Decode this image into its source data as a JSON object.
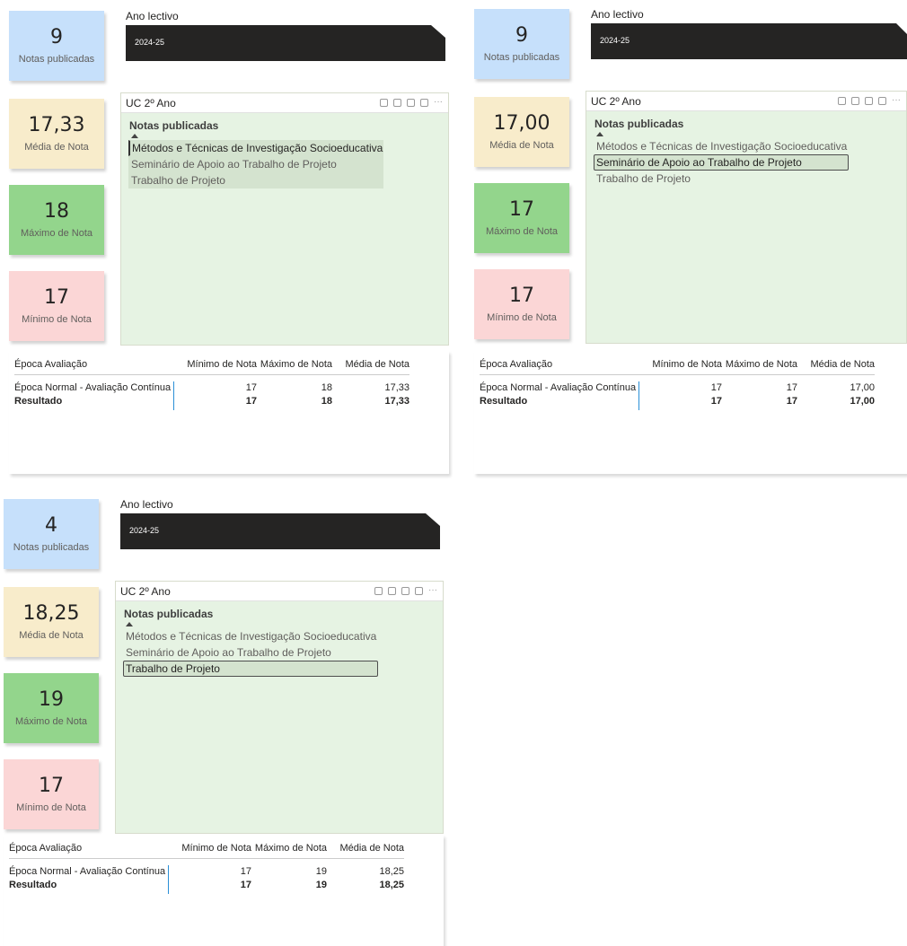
{
  "panels": [
    {
      "notas_publicadas": {
        "value": "9",
        "label": "Notas publicadas"
      },
      "media_nota": {
        "value": "17,33",
        "label": "Média de Nota"
      },
      "maximo_nota": {
        "value": "18",
        "label": "Máximo de Nota"
      },
      "minimo_nota": {
        "value": "17",
        "label": "Mínimo de Nota"
      },
      "ano_lectivo": {
        "label": "Ano lectivo",
        "value": "2024-25"
      },
      "uc": {
        "title": "UC 2º Ano",
        "list_header": "Notas publicadas",
        "items": [
          "Métodos e Técnicas de Investigação Socioeducativa",
          "Seminário de Apoio ao Trabalho de Projeto",
          "Trabalho de Projeto"
        ]
      },
      "table": {
        "headers": [
          "Época Avaliação",
          "Mínimo de Nota",
          "Máximo de Nota",
          "Média de Nota"
        ],
        "row": [
          "Época Normal - Avaliação Contínua",
          "17",
          "18",
          "17,33"
        ],
        "total": [
          "Resultado",
          "17",
          "18",
          "17,33"
        ]
      }
    },
    {
      "notas_publicadas": {
        "value": "9",
        "label": "Notas publicadas"
      },
      "media_nota": {
        "value": "17,00",
        "label": "Média de Nota"
      },
      "maximo_nota": {
        "value": "17",
        "label": "Máximo de Nota"
      },
      "minimo_nota": {
        "value": "17",
        "label": "Mínimo de Nota"
      },
      "ano_lectivo": {
        "label": "Ano lectivo",
        "value": "2024-25"
      },
      "uc": {
        "title": "UC 2º Ano",
        "list_header": "Notas publicadas",
        "items": [
          "Métodos e Técnicas de Investigação Socioeducativa",
          "Seminário de Apoio ao Trabalho de Projeto",
          "Trabalho de Projeto"
        ]
      },
      "table": {
        "headers": [
          "Época Avaliação",
          "Mínimo de Nota",
          "Máximo de Nota",
          "Média de Nota"
        ],
        "row": [
          "Época Normal - Avaliação Contínua",
          "17",
          "17",
          "17,00"
        ],
        "total": [
          "Resultado",
          "17",
          "17",
          "17,00"
        ]
      }
    },
    {
      "notas_publicadas": {
        "value": "4",
        "label": "Notas publicadas"
      },
      "media_nota": {
        "value": "18,25",
        "label": "Média de Nota"
      },
      "maximo_nota": {
        "value": "19",
        "label": "Máximo de Nota"
      },
      "minimo_nota": {
        "value": "17",
        "label": "Mínimo de Nota"
      },
      "ano_lectivo": {
        "label": "Ano lectivo",
        "value": "2024-25"
      },
      "uc": {
        "title": "UC 2º Ano",
        "list_header": "Notas publicadas",
        "items": [
          "Métodos e Técnicas de Investigação Socioeducativa",
          "Seminário de Apoio ao Trabalho de Projeto",
          "Trabalho de Projeto"
        ]
      },
      "table": {
        "headers": [
          "Época Avaliação",
          "Mínimo de Nota",
          "Máximo de Nota",
          "Média de Nota"
        ],
        "row": [
          "Época Normal - Avaliação Contínua",
          "17",
          "19",
          "18,25"
        ],
        "total": [
          "Resultado",
          "17",
          "19",
          "18,25"
        ]
      }
    }
  ],
  "colors": {
    "notas_card": "#c6e0fb",
    "media_card": "#f8eccb",
    "maximo_card": "#93d58c",
    "minimo_card": "#fbd6d6",
    "ano_slicer": "#252423",
    "uc_background": "#e6f3e3",
    "table_divider": "#2a8fd7"
  },
  "icons": [
    "copy-icon",
    "pin-icon",
    "filter-icon",
    "focus-mode-icon",
    "more-options-icon"
  ]
}
